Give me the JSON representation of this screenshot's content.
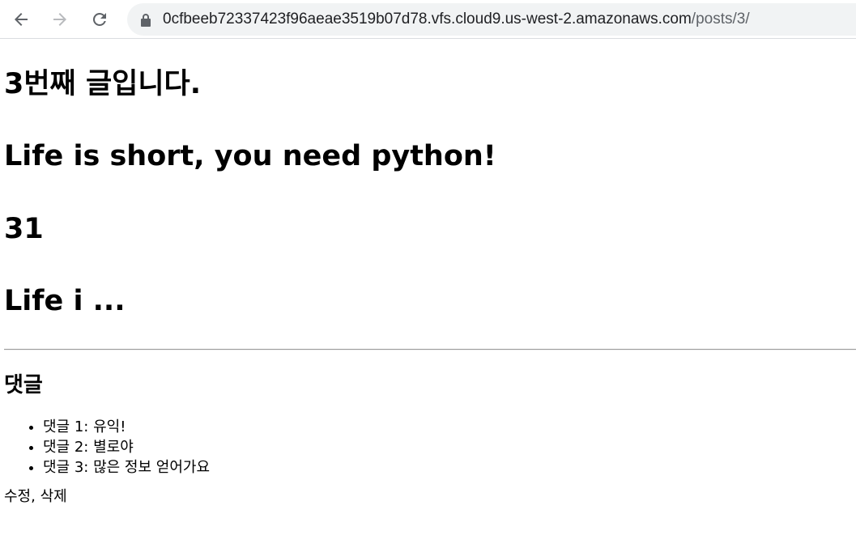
{
  "browser": {
    "url_host": "0cfbeeb72337423f96aeae3519b07d78.vfs.cloud9.us-west-2.amazonaws.com",
    "url_path": "/posts/3/",
    "back_icon": "arrow-left-icon",
    "forward_icon": "arrow-right-icon",
    "reload_icon": "reload-icon",
    "lock_icon": "lock-icon"
  },
  "post": {
    "title": "3번째 글입니다.",
    "content": "Life is short, you need python!",
    "number": "31",
    "excerpt": "Life i ..."
  },
  "comments": {
    "heading": "댓글",
    "items": [
      "댓글 1: 유익!",
      "댓글 2: 별로야",
      "댓글 3: 많은 정보 얻어가요"
    ]
  },
  "actions": {
    "edit_label": "수정",
    "separator": ", ",
    "delete_label": "삭제"
  }
}
